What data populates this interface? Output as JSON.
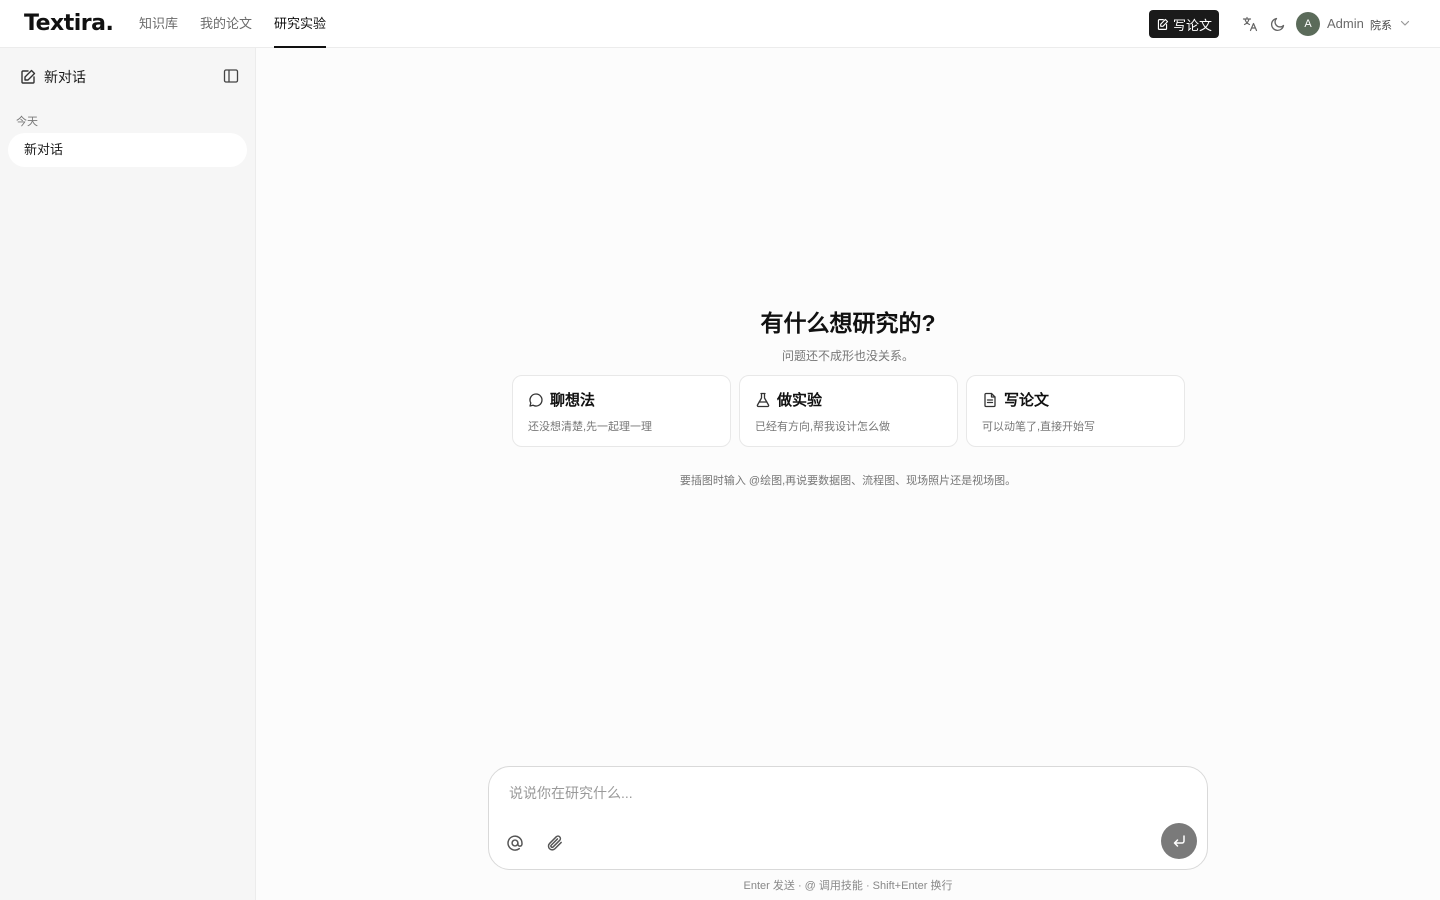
{
  "header": {
    "logo": "Textira.",
    "nav": [
      {
        "label": "知识库"
      },
      {
        "label": "我的论文"
      },
      {
        "label": "研究实验"
      }
    ],
    "write_button": "写论文",
    "user": {
      "avatar_initial": "A",
      "name": "Admin",
      "role": "院系"
    }
  },
  "sidebar": {
    "new_chat": "新对话",
    "section": "今天",
    "conversations": [
      {
        "title": "新对话"
      }
    ]
  },
  "main": {
    "title": "有什么想研究的?",
    "subtitle": "问题还不成形也没关系。",
    "cards": [
      {
        "icon": "chat-bubble-icon",
        "title": "聊想法",
        "desc": "还没想清楚,先一起理一理"
      },
      {
        "icon": "flask-icon",
        "title": "做实验",
        "desc": "已经有方向,帮我设计怎么做"
      },
      {
        "icon": "document-icon",
        "title": "写论文",
        "desc": "可以动笔了,直接开始写"
      }
    ],
    "hint": "要插图时输入 @绘图,再说要数据图、流程图、现场照片还是视场图。"
  },
  "composer": {
    "placeholder": "说说你在研究什么...",
    "value": "",
    "footer": "Enter 发送 · @ 调用技能 · Shift+Enter 换行"
  }
}
